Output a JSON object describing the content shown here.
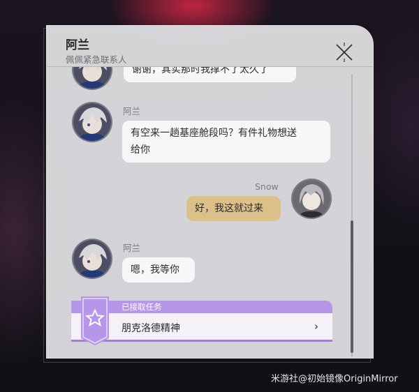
{
  "header": {
    "title": "阿兰",
    "subtitle": "佩佩紧急联系人"
  },
  "messages": [
    {
      "sender": "",
      "text": "谢谢，其实那时我撑不了太久了"
    },
    {
      "sender": "阿兰",
      "text_line1": "有空来一趟基座舱段吗？有件礼物想送",
      "text_line2": "给你"
    },
    {
      "sender": "Snow",
      "text": "好，我这就过来"
    },
    {
      "sender": "阿兰",
      "text": "嗯，我等你"
    }
  ],
  "quest": {
    "status": "已接取任务",
    "name": "朋克洛德精神",
    "chevron": "›"
  },
  "icons": {
    "close": "close-icon",
    "quest": "star-badge-icon",
    "arrow": "chevron-right-icon"
  },
  "colors": {
    "my_bubble": "#dcc089",
    "other_bubble": "#f7f7f8",
    "quest_accent": "#b596e8"
  },
  "watermark": "米游社@初始镜像OriginMirror"
}
